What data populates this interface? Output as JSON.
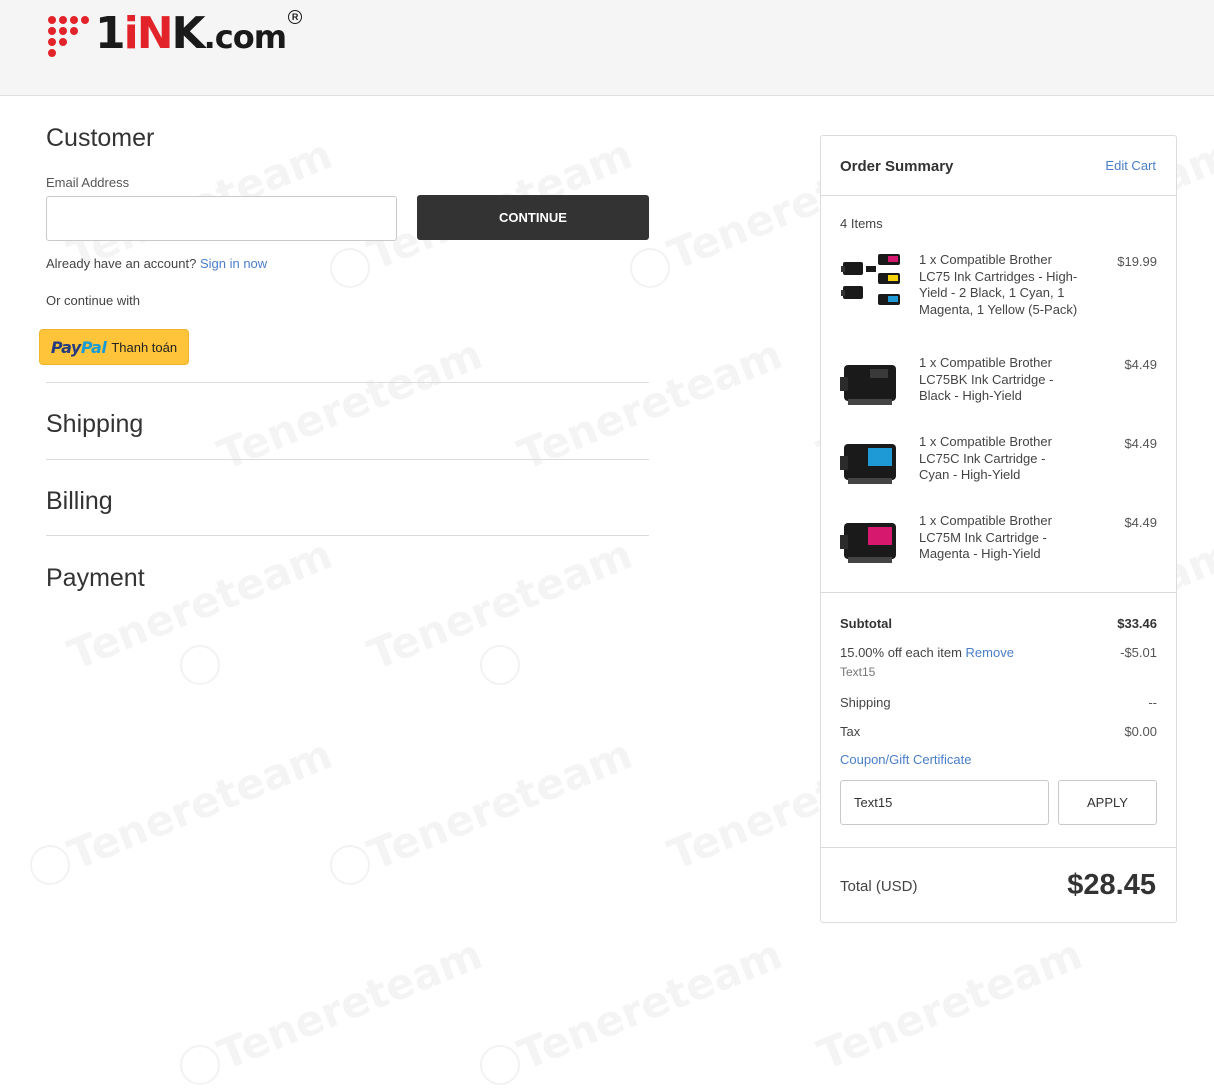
{
  "header": {
    "logo": {
      "text": "1INK.com",
      "registered": "R"
    }
  },
  "customer": {
    "title": "Customer",
    "email_label": "Email Address",
    "email_value": "",
    "continue_label": "CONTINUE",
    "account_prompt": "Already have an account?",
    "sign_in_label": "Sign in now",
    "continue_with": "Or continue with",
    "paypal": {
      "brand_1": "Pay",
      "brand_2": "Pal",
      "label": "Thanh toán"
    }
  },
  "sections": {
    "shipping": "Shipping",
    "billing": "Billing",
    "payment": "Payment"
  },
  "summary": {
    "title": "Order Summary",
    "edit_cart": "Edit Cart",
    "items_count": "4 Items",
    "items": [
      {
        "desc": "1 x Compatible Brother LC75 Ink Cartridges - High-Yield - 2 Black, 1 Cyan, 1 Magenta, 1 Yellow (5-Pack)",
        "price": "$19.99",
        "image": "multipack-cartridges"
      },
      {
        "desc": "1 x Compatible Brother LC75BK Ink Cartridge - Black - High-Yield",
        "price": "$4.49",
        "image": "black-cartridge"
      },
      {
        "desc": "1 x Compatible Brother LC75C Ink Cartridge - Cyan - High-Yield",
        "price": "$4.49",
        "image": "cyan-cartridge"
      },
      {
        "desc": "1 x Compatible Brother LC75M Ink Cartridge - Magenta - High-Yield",
        "price": "$4.49",
        "image": "magenta-cartridge"
      }
    ],
    "subtotal_label": "Subtotal",
    "subtotal_value": "$33.46",
    "discount_label": "15.00% off each item",
    "discount_remove": "Remove",
    "discount_value": "-$5.01",
    "promo_code": "Text15",
    "shipping_label": "Shipping",
    "shipping_value": "--",
    "tax_label": "Tax",
    "tax_value": "$0.00",
    "coupon_link": "Coupon/Gift Certificate",
    "coupon_value": "Text15",
    "apply_label": "APPLY",
    "total_label": "Total (USD)",
    "total_value": "$28.45"
  },
  "watermark": {
    "text": "Tenereteam"
  },
  "colors": {
    "accent_link": "#4a7ec9",
    "button_dark": "#333333",
    "paypal_yellow": "#ffc439",
    "brand_red": "#e3232a",
    "cyan": "#1e9bd7",
    "magenta": "#d6186e",
    "yellow": "#f5d20c"
  }
}
